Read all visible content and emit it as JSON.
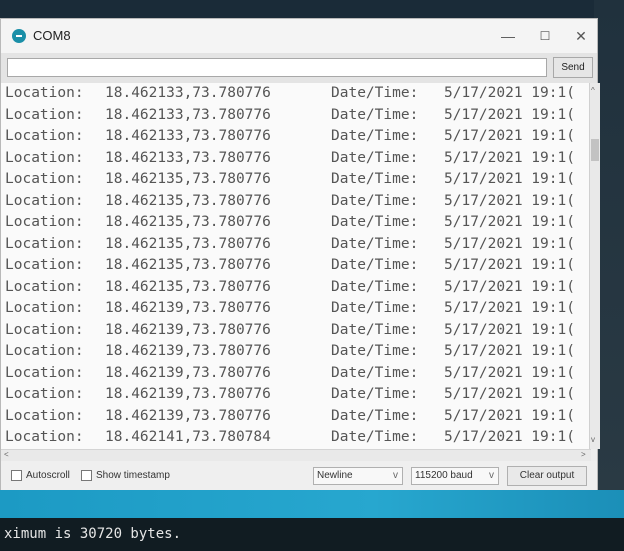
{
  "window": {
    "title": "COM8",
    "controls": {
      "minimize": "—",
      "maximize": "☐",
      "close": "✕"
    }
  },
  "send": {
    "input_value": "",
    "button_label": "Send"
  },
  "log": {
    "rows": [
      {
        "loc_label": "Location:",
        "coords": "18.462133,73.780776",
        "dt_label": "Date/Time:",
        "datetime": "5/17/2021 19:1("
      },
      {
        "loc_label": "Location:",
        "coords": "18.462133,73.780776",
        "dt_label": "Date/Time:",
        "datetime": "5/17/2021 19:1("
      },
      {
        "loc_label": "Location:",
        "coords": "18.462133,73.780776",
        "dt_label": "Date/Time:",
        "datetime": "5/17/2021 19:1("
      },
      {
        "loc_label": "Location:",
        "coords": "18.462133,73.780776",
        "dt_label": "Date/Time:",
        "datetime": "5/17/2021 19:1("
      },
      {
        "loc_label": "Location:",
        "coords": "18.462135,73.780776",
        "dt_label": "Date/Time:",
        "datetime": "5/17/2021 19:1("
      },
      {
        "loc_label": "Location:",
        "coords": "18.462135,73.780776",
        "dt_label": "Date/Time:",
        "datetime": "5/17/2021 19:1("
      },
      {
        "loc_label": "Location:",
        "coords": "18.462135,73.780776",
        "dt_label": "Date/Time:",
        "datetime": "5/17/2021 19:1("
      },
      {
        "loc_label": "Location:",
        "coords": "18.462135,73.780776",
        "dt_label": "Date/Time:",
        "datetime": "5/17/2021 19:1("
      },
      {
        "loc_label": "Location:",
        "coords": "18.462135,73.780776",
        "dt_label": "Date/Time:",
        "datetime": "5/17/2021 19:1("
      },
      {
        "loc_label": "Location:",
        "coords": "18.462135,73.780776",
        "dt_label": "Date/Time:",
        "datetime": "5/17/2021 19:1("
      },
      {
        "loc_label": "Location:",
        "coords": "18.462139,73.780776",
        "dt_label": "Date/Time:",
        "datetime": "5/17/2021 19:1("
      },
      {
        "loc_label": "Location:",
        "coords": "18.462139,73.780776",
        "dt_label": "Date/Time:",
        "datetime": "5/17/2021 19:1("
      },
      {
        "loc_label": "Location:",
        "coords": "18.462139,73.780776",
        "dt_label": "Date/Time:",
        "datetime": "5/17/2021 19:1("
      },
      {
        "loc_label": "Location:",
        "coords": "18.462139,73.780776",
        "dt_label": "Date/Time:",
        "datetime": "5/17/2021 19:1("
      },
      {
        "loc_label": "Location:",
        "coords": "18.462139,73.780776",
        "dt_label": "Date/Time:",
        "datetime": "5/17/2021 19:1("
      },
      {
        "loc_label": "Location:",
        "coords": "18.462139,73.780776",
        "dt_label": "Date/Time:",
        "datetime": "5/17/2021 19:1("
      },
      {
        "loc_label": "Location:",
        "coords": "18.462141,73.780784",
        "dt_label": "Date/Time:",
        "datetime": "5/17/2021 19:1("
      }
    ]
  },
  "scrollbars": {
    "up": "^",
    "down": "v",
    "left": "<",
    "right": ">"
  },
  "status": {
    "autoscroll_label": "Autoscroll",
    "timestamp_label": "Show timestamp",
    "line_ending": "Newline",
    "baud": "115200 baud",
    "chevron": "v",
    "clear_label": "Clear output"
  },
  "console": {
    "text": "ximum is 30720 bytes."
  }
}
